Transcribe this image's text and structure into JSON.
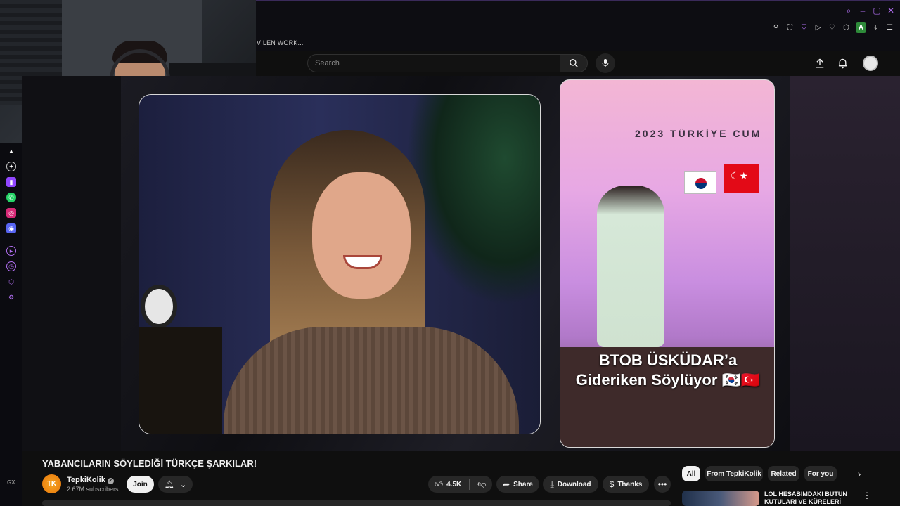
{
  "browser": {
    "tab_crumb": "VILEN WORK...",
    "ext_avatar_letter": "A"
  },
  "masthead": {
    "search_placeholder": "Search"
  },
  "player": {
    "right_caption_line1": "BTOB ÜSKÜDAR’a",
    "right_caption_line2": "Gideriken Söylüyor 🇰🇷🇹🇷",
    "right_banner": "2023 TÜRKİYE CUM"
  },
  "video": {
    "title": "YABANCILARIN SÖYLEDİĞİ TÜRKÇE ŞARKILAR!",
    "channel": {
      "avatar_text": "TK",
      "name": "TepkiKolik",
      "subscribers": "2.67M subscribers"
    },
    "actions": {
      "join": "Join",
      "likes": "4.5K",
      "share": "Share",
      "download": "Download",
      "thanks": "Thanks"
    }
  },
  "related": {
    "chips": [
      "All",
      "From TepkiKolik",
      "Related",
      "For you"
    ],
    "first_item_title": "LOL HESABIMDAKİ BÜTÜN KUTULARI VE KÜRELERİ"
  },
  "sidebar": {
    "gx_label": "GX"
  },
  "colors": {
    "accent": "#b06ef0",
    "background": "#0f0f0f",
    "chip_bg": "#272727"
  }
}
